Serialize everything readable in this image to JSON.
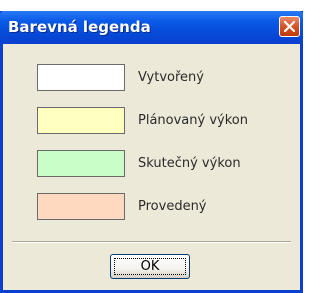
{
  "window": {
    "title": "Barevná legenda",
    "close_icon": "close-icon",
    "title_color": "#0a5ae8"
  },
  "legend": {
    "items": [
      {
        "label": "Vytvořený",
        "color": "#ffffff"
      },
      {
        "label": "Plánovaný výkon",
        "color": "#ffffc0"
      },
      {
        "label": "Skutečný výkon",
        "color": "#c8ffc8"
      },
      {
        "label": "Provedený",
        "color": "#ffd8c0"
      }
    ]
  },
  "buttons": {
    "ok_label": "OK"
  }
}
